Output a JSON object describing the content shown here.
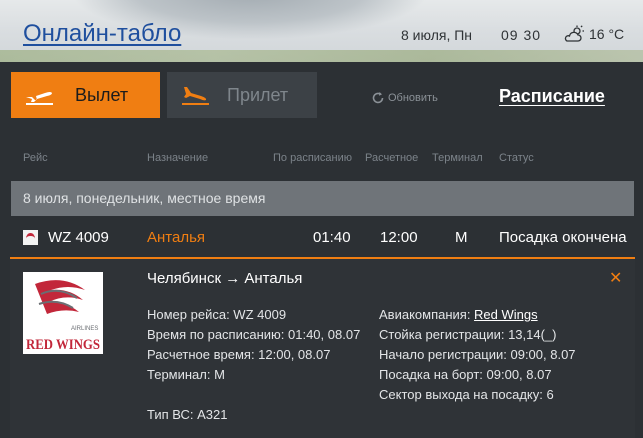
{
  "header": {
    "title": "Онлайн-табло",
    "date": "8 июля, Пн",
    "time": "09 30",
    "temperature": "16 °C",
    "weather_icon": "partly-cloudy-icon"
  },
  "tabs": {
    "departure": "Вылет",
    "arrival": "Прилет",
    "refresh": "Обновить",
    "schedule": "Расписание"
  },
  "columns": {
    "flight": "Рейс",
    "destination": "Назначение",
    "scheduled": "По расписанию",
    "estimated": "Расчетное",
    "terminal": "Терминал",
    "status": "Статус"
  },
  "date_bar": "8 июля, понедельник, местное время",
  "flight": {
    "number": "WZ 4009",
    "destination": "Анталья",
    "scheduled": "01:40",
    "estimated": "12:00",
    "terminal": "M",
    "status": "Посадка окончена"
  },
  "details": {
    "route": "Челябинск → Анталья",
    "flight_number": "Номер рейса: WZ 4009",
    "scheduled_time": "Время по расписанию: 01:40, 08.07",
    "estimated_time": "Расчетное время: 12:00, 08.07",
    "terminal": "Терминал: M",
    "aircraft": "Тип ВС: A321",
    "airline_label": "Авиакомпания: ",
    "airline_name": "Red Wings",
    "checkin_desk": "Стойка регистрации: 13,14(_)",
    "checkin_start": "Начало регистрации: 09:00, 8.07",
    "boarding": "Посадка на борт: 09:00, 8.07",
    "gate": "Сектор выхода на посадку: 6",
    "logo_small": "AIRLINES",
    "logo_main": "RED WINGS"
  },
  "colors": {
    "accent": "#f07e12",
    "panel": "#2c3034",
    "link": "#1f4f9e",
    "brand_red": "#c2273a"
  }
}
